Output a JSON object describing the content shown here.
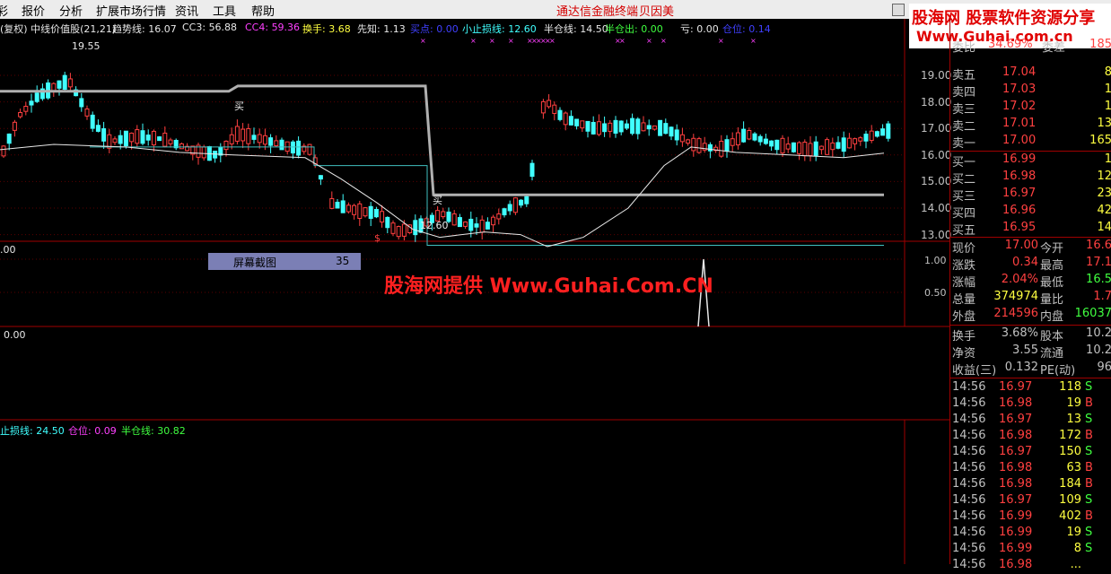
{
  "menu": {
    "items": [
      "彩",
      "报价",
      "分析",
      "扩展市场行情",
      "资讯",
      "工具",
      "帮助"
    ],
    "center_items": [
      "通达信金融终端",
      "贝因美"
    ]
  },
  "logo": {
    "line1": "股海网 股票软件资源分享",
    "line2": "Www.Guhai.com.cn"
  },
  "indicator_bar": {
    "prefix": "(复权) 中线价值股(21,21)",
    "items": [
      {
        "text": "趋势线: 16.07",
        "color": "#e8e8e8"
      },
      {
        "text": "CC3: 56.88",
        "color": "#e8e8e8"
      },
      {
        "text": "CC4: 59.36",
        "color": "#ff40ff"
      },
      {
        "text": "换手: 3.68",
        "color": "#ffff40"
      },
      {
        "text": "先知: 1.13",
        "color": "#e8e8e8"
      },
      {
        "text": "买点: 0.00",
        "color": "#4040ff"
      },
      {
        "text": "小止损线: 12.60",
        "color": "#40ffff"
      },
      {
        "text": "半仓线: 14.50",
        "color": "#e8e8e8"
      },
      {
        "text": "半仓出: 0.00",
        "color": "#40ff40"
      },
      {
        "text": "亏: 0.00",
        "color": "#e8e8e8"
      },
      {
        "text": "仓位: 0.14",
        "color": "#4040ff"
      }
    ]
  },
  "price_axis": [
    "19.00",
    "18.00",
    "17.00",
    "16.00",
    "15.00",
    "14.00",
    "13.00"
  ],
  "annotations": {
    "high": "19.55",
    "low": "12.60",
    "buy1": "买",
    "buy2": "买",
    "sell_mark": "$"
  },
  "pane2": {
    "left_value": ".00",
    "axis": [
      "1.00",
      "0.50"
    ]
  },
  "pane3": {
    "left_value": "0.00"
  },
  "pane4": {
    "items": [
      {
        "text": "止损线: 24.50",
        "color": "#40ffff"
      },
      {
        "text": "仓位: 0.09",
        "color": "#ff40ff"
      },
      {
        "text": "半仓线: 30.82",
        "color": "#40ff40"
      }
    ]
  },
  "screenshot_label": {
    "text": "屏幕截图",
    "count": "35"
  },
  "watermark": "股海网提供 Www.Guhai.Com.CN",
  "quote": {
    "top_partial": [
      "委比",
      "34.69%",
      "委差",
      "185"
    ],
    "sell": [
      {
        "label": "卖五",
        "price": "17.04",
        "vol": "8"
      },
      {
        "label": "卖四",
        "price": "17.03",
        "vol": "1"
      },
      {
        "label": "卖三",
        "price": "17.02",
        "vol": "1"
      },
      {
        "label": "卖二",
        "price": "17.01",
        "vol": "13"
      },
      {
        "label": "卖一",
        "price": "17.00",
        "vol": "165"
      }
    ],
    "buy": [
      {
        "label": "买一",
        "price": "16.99",
        "vol": "1"
      },
      {
        "label": "买二",
        "price": "16.98",
        "vol": "12"
      },
      {
        "label": "买三",
        "price": "16.97",
        "vol": "23"
      },
      {
        "label": "买四",
        "price": "16.96",
        "vol": "42"
      },
      {
        "label": "买五",
        "price": "16.95",
        "vol": "14"
      }
    ],
    "stats": [
      {
        "l1": "现价",
        "v1": "17.00",
        "c1": "#ff4040",
        "l2": "今开",
        "v2": "16.6",
        "c2": "#ff4040"
      },
      {
        "l1": "涨跌",
        "v1": "0.34",
        "c1": "#ff4040",
        "l2": "最高",
        "v2": "17.1",
        "c2": "#ff4040"
      },
      {
        "l1": "涨幅",
        "v1": "2.04%",
        "c1": "#ff4040",
        "l2": "最低",
        "v2": "16.5",
        "c2": "#40ff40"
      },
      {
        "l1": "总量",
        "v1": "374974",
        "c1": "#ffff40",
        "l2": "量比",
        "v2": "1.7",
        "c2": "#ff4040"
      },
      {
        "l1": "外盘",
        "v1": "214596",
        "c1": "#ff4040",
        "l2": "内盘",
        "v2": "16037",
        "c2": "#40ff40"
      }
    ],
    "fund": [
      {
        "l1": "换手",
        "v1": "3.68%",
        "l2": "股本",
        "v2": "10.2"
      },
      {
        "l1": "净资",
        "v1": "3.55",
        "l2": "流通",
        "v2": "10.2"
      },
      {
        "l1": "收益(三)",
        "v1": "0.132",
        "l2": "PE(动)",
        "v2": "96"
      }
    ],
    "ticks": [
      {
        "time": "14:56",
        "price": "16.97",
        "vol": "118",
        "side": "S"
      },
      {
        "time": "14:56",
        "price": "16.98",
        "vol": "19",
        "side": "B"
      },
      {
        "time": "14:56",
        "price": "16.97",
        "vol": "13",
        "side": "S"
      },
      {
        "time": "14:56",
        "price": "16.98",
        "vol": "172",
        "side": "B"
      },
      {
        "time": "14:56",
        "price": "16.97",
        "vol": "150",
        "side": "S"
      },
      {
        "time": "14:56",
        "price": "16.98",
        "vol": "63",
        "side": "B"
      },
      {
        "time": "14:56",
        "price": "16.98",
        "vol": "184",
        "side": "B"
      },
      {
        "time": "14:56",
        "price": "16.97",
        "vol": "109",
        "side": "S"
      },
      {
        "time": "14:56",
        "price": "16.99",
        "vol": "402",
        "side": "B"
      },
      {
        "time": "14:56",
        "price": "16.99",
        "vol": "19",
        "side": "S"
      },
      {
        "time": "14:56",
        "price": "16.99",
        "vol": "8",
        "side": "S"
      },
      {
        "time": "14:56",
        "price": "16.98",
        "vol": "...",
        "side": ""
      }
    ]
  },
  "colors": {
    "up": "#ff4040",
    "down": "#40ffff",
    "buy": "#ff4040",
    "sell": "#40ff40",
    "grid": "#a00000"
  }
}
